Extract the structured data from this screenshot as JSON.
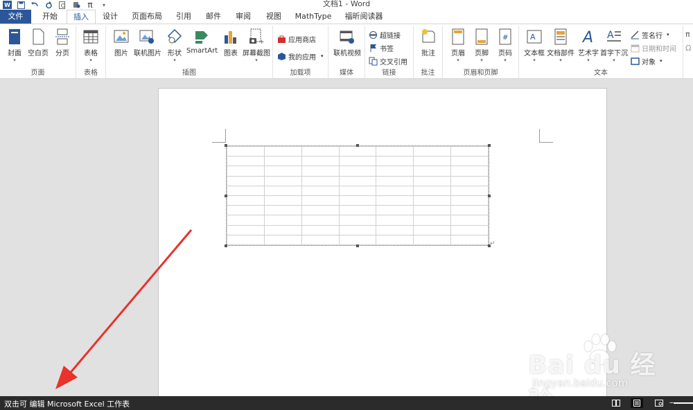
{
  "window": {
    "title": "文档1 - Word"
  },
  "quick_access": {
    "icons": [
      "word-logo",
      "save-icon",
      "undo-icon",
      "redo-icon",
      "print-preview-icon",
      "touch-icon",
      "pi-icon",
      "customize-icon"
    ],
    "pi_label": "π"
  },
  "tabs": [
    "文件",
    "开始",
    "插入",
    "设计",
    "页面布局",
    "引用",
    "邮件",
    "审阅",
    "视图",
    "MathType",
    "福昕阅读器"
  ],
  "active_tab": "插入",
  "ribbon": {
    "groups": {
      "pages": {
        "label": "页面",
        "items": [
          "封面",
          "空白页",
          "分页"
        ]
      },
      "tables": {
        "label": "表格",
        "items": [
          "表格"
        ]
      },
      "illustrations": {
        "label": "插图",
        "items": [
          "图片",
          "联机图片",
          "形状",
          "SmartArt",
          "图表",
          "屏幕截图"
        ]
      },
      "addins": {
        "label": "加载项",
        "items": [
          "应用商店",
          "我的应用"
        ]
      },
      "media": {
        "label": "媒体",
        "items": [
          "联机视频"
        ]
      },
      "links": {
        "label": "链接",
        "items": [
          "超链接",
          "书签",
          "交叉引用"
        ]
      },
      "comments": {
        "label": "批注",
        "items": [
          "批注"
        ]
      },
      "header_footer": {
        "label": "页眉和页脚",
        "items": [
          "页眉",
          "页脚",
          "页码"
        ]
      },
      "text": {
        "label": "文本",
        "items": [
          "文本框",
          "文档部件",
          "艺术字",
          "首字下沉",
          "签名行",
          "日期和时间",
          "对象"
        ]
      }
    }
  },
  "document": {
    "embedded_object": "Microsoft Excel 工作表",
    "grid_rows": 10,
    "grid_cols": 7
  },
  "statusbar": {
    "text": "双击可 编辑 Microsoft Excel 工作表"
  },
  "watermark": {
    "brand": "Bai du 经验",
    "url": "jingyan.baidu.com"
  },
  "colors": {
    "accent": "#2b579a",
    "statusbar": "#2b2b2b",
    "arrow": "#e8322a"
  }
}
